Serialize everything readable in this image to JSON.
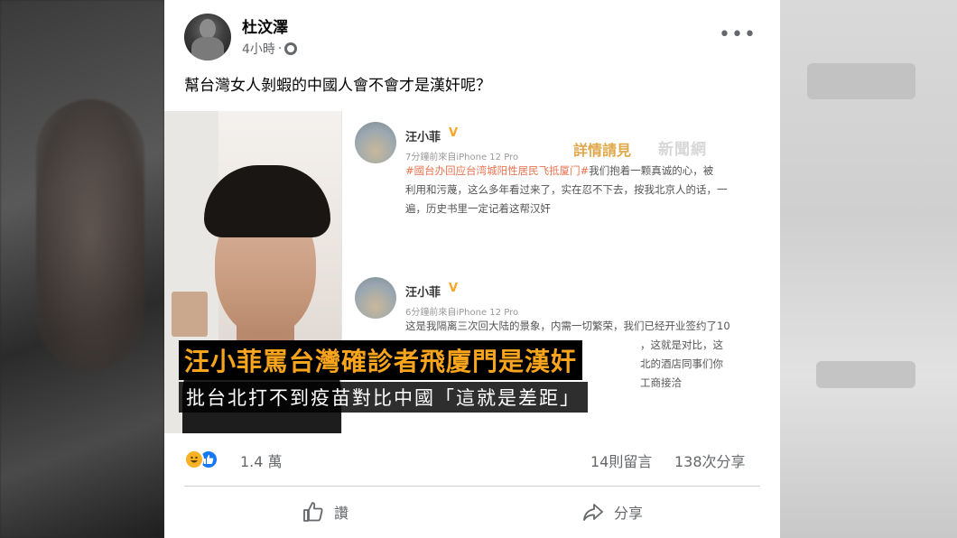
{
  "colors": {
    "caption_yellow": "#f8a51d",
    "fb_blue": "#1877f2",
    "muted_text": "#65676b",
    "weibo_tag": "#eb7350",
    "vip_badge": "#f6a623"
  },
  "post": {
    "author": "杜汶澤",
    "time": "4小時",
    "separator": "·",
    "privacy_icon": "globe-icon",
    "more_label": "•••",
    "text": "幫台灣女人剝蝦的中國人會不會才是漢奸呢？"
  },
  "media": {
    "stamp": "詳情請見",
    "stamp_logo": "新聞網",
    "caption_line1": "汪小菲罵台灣確診者飛廈門是漢奸",
    "caption_line2": "批台北打不到疫苗對比中國「這就是差距」",
    "weibo_posts": [
      {
        "name": "汪小菲",
        "badge": "V",
        "time": "7分鐘前來自iPhone 12 Pro",
        "tag": "#國台办回应台湾城阳性居民飞抵厦门#",
        "line1": "我们抱着一颗真诚的心，被",
        "line2": "利用和污蔑，这么多年看过来了，实在忍不下去，按我北京人的话，一",
        "line3": "遍，历史书里一定记着这帮汉奸"
      },
      {
        "name": "汪小菲",
        "badge": "V",
        "time": "6分鐘前來自iPhone 12 Pro",
        "line1": "这是我隔离三次回大陆的景象，内需一切繁荣，我们已经开业签约了10",
        "line2": "，这就是对比，这",
        "line3": "北的酒店同事们你",
        "line4": "工商接洽"
      }
    ]
  },
  "stats": {
    "reaction_icons": [
      "haha-icon",
      "like-icon"
    ],
    "reaction_count": "1.4 萬",
    "comments": "14則留言",
    "shares": "138次分享"
  },
  "actions": {
    "like_label": "讚",
    "like_icon": "thumbs-up-icon",
    "share_label": "分享",
    "share_icon": "share-arrow-icon"
  }
}
